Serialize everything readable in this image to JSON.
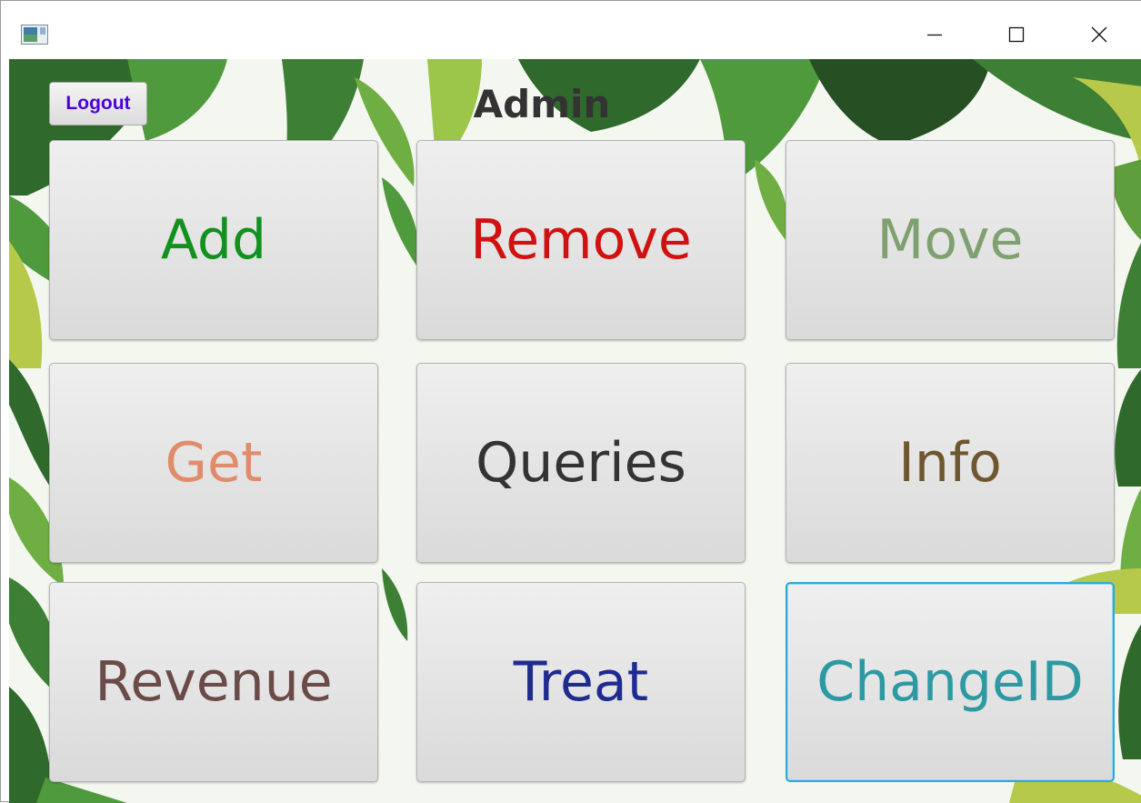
{
  "window": {
    "minimize_icon": "minimize-icon",
    "maximize_icon": "maximize-icon",
    "close_icon": "close-icon"
  },
  "header": {
    "title": "Admin",
    "logout_label": "Logout"
  },
  "buttons": [
    {
      "label": "Add",
      "color": "#12911e"
    },
    {
      "label": "Remove",
      "color": "#d0110f"
    },
    {
      "label": "Move",
      "color": "#7fa06f"
    },
    {
      "label": "Get",
      "color": "#e08c6a"
    },
    {
      "label": "Queries",
      "color": "#333333"
    },
    {
      "label": "Info",
      "color": "#6e5630"
    },
    {
      "label": "Revenue",
      "color": "#6a4b47"
    },
    {
      "label": "Treat",
      "color": "#202b8f"
    },
    {
      "label": "ChangeID",
      "color": "#2d9aa3"
    }
  ],
  "colors": {
    "logout_text": "#4b00d9",
    "focus_ring": "#2ba9da",
    "leaf_dark": "#2f6a2c",
    "leaf_mid": "#4f9a3c",
    "leaf_light": "#9cc64a"
  }
}
